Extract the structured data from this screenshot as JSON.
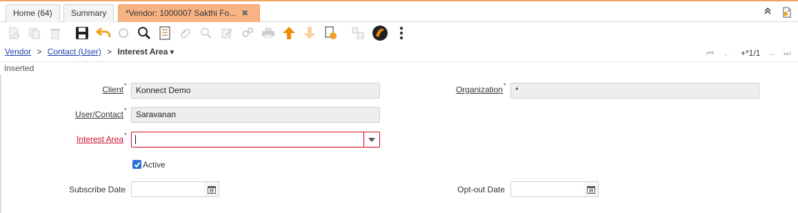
{
  "tabs": [
    {
      "label": "Home (64)"
    },
    {
      "label": "Summary"
    },
    {
      "label": "*Vendor: 1000007 Sakthi Fo..."
    }
  ],
  "breadcrumb": {
    "items": [
      "Vendor",
      "Contact (User)"
    ],
    "current": "Interest Area",
    "separator": ">"
  },
  "record_nav": {
    "text": "+*1/1"
  },
  "status": "Inserted",
  "form": {
    "client": {
      "label": "Client",
      "value": "Konnect Demo"
    },
    "organization": {
      "label": "Organization",
      "value": "*"
    },
    "user_contact": {
      "label": "User/Contact",
      "value": "Saravanan"
    },
    "interest_area": {
      "label": "Interest Area",
      "value": ""
    },
    "active": {
      "label": "Active",
      "checked": true
    },
    "subscribe_date": {
      "label": "Subscribe Date",
      "value": ""
    },
    "opt_out_date": {
      "label": "Opt-out Date",
      "value": ""
    }
  },
  "colors": {
    "active_tab": "#f7b384",
    "required_label": "#c8102e",
    "link": "#1b3ea8",
    "accent": "#f0a35e"
  }
}
